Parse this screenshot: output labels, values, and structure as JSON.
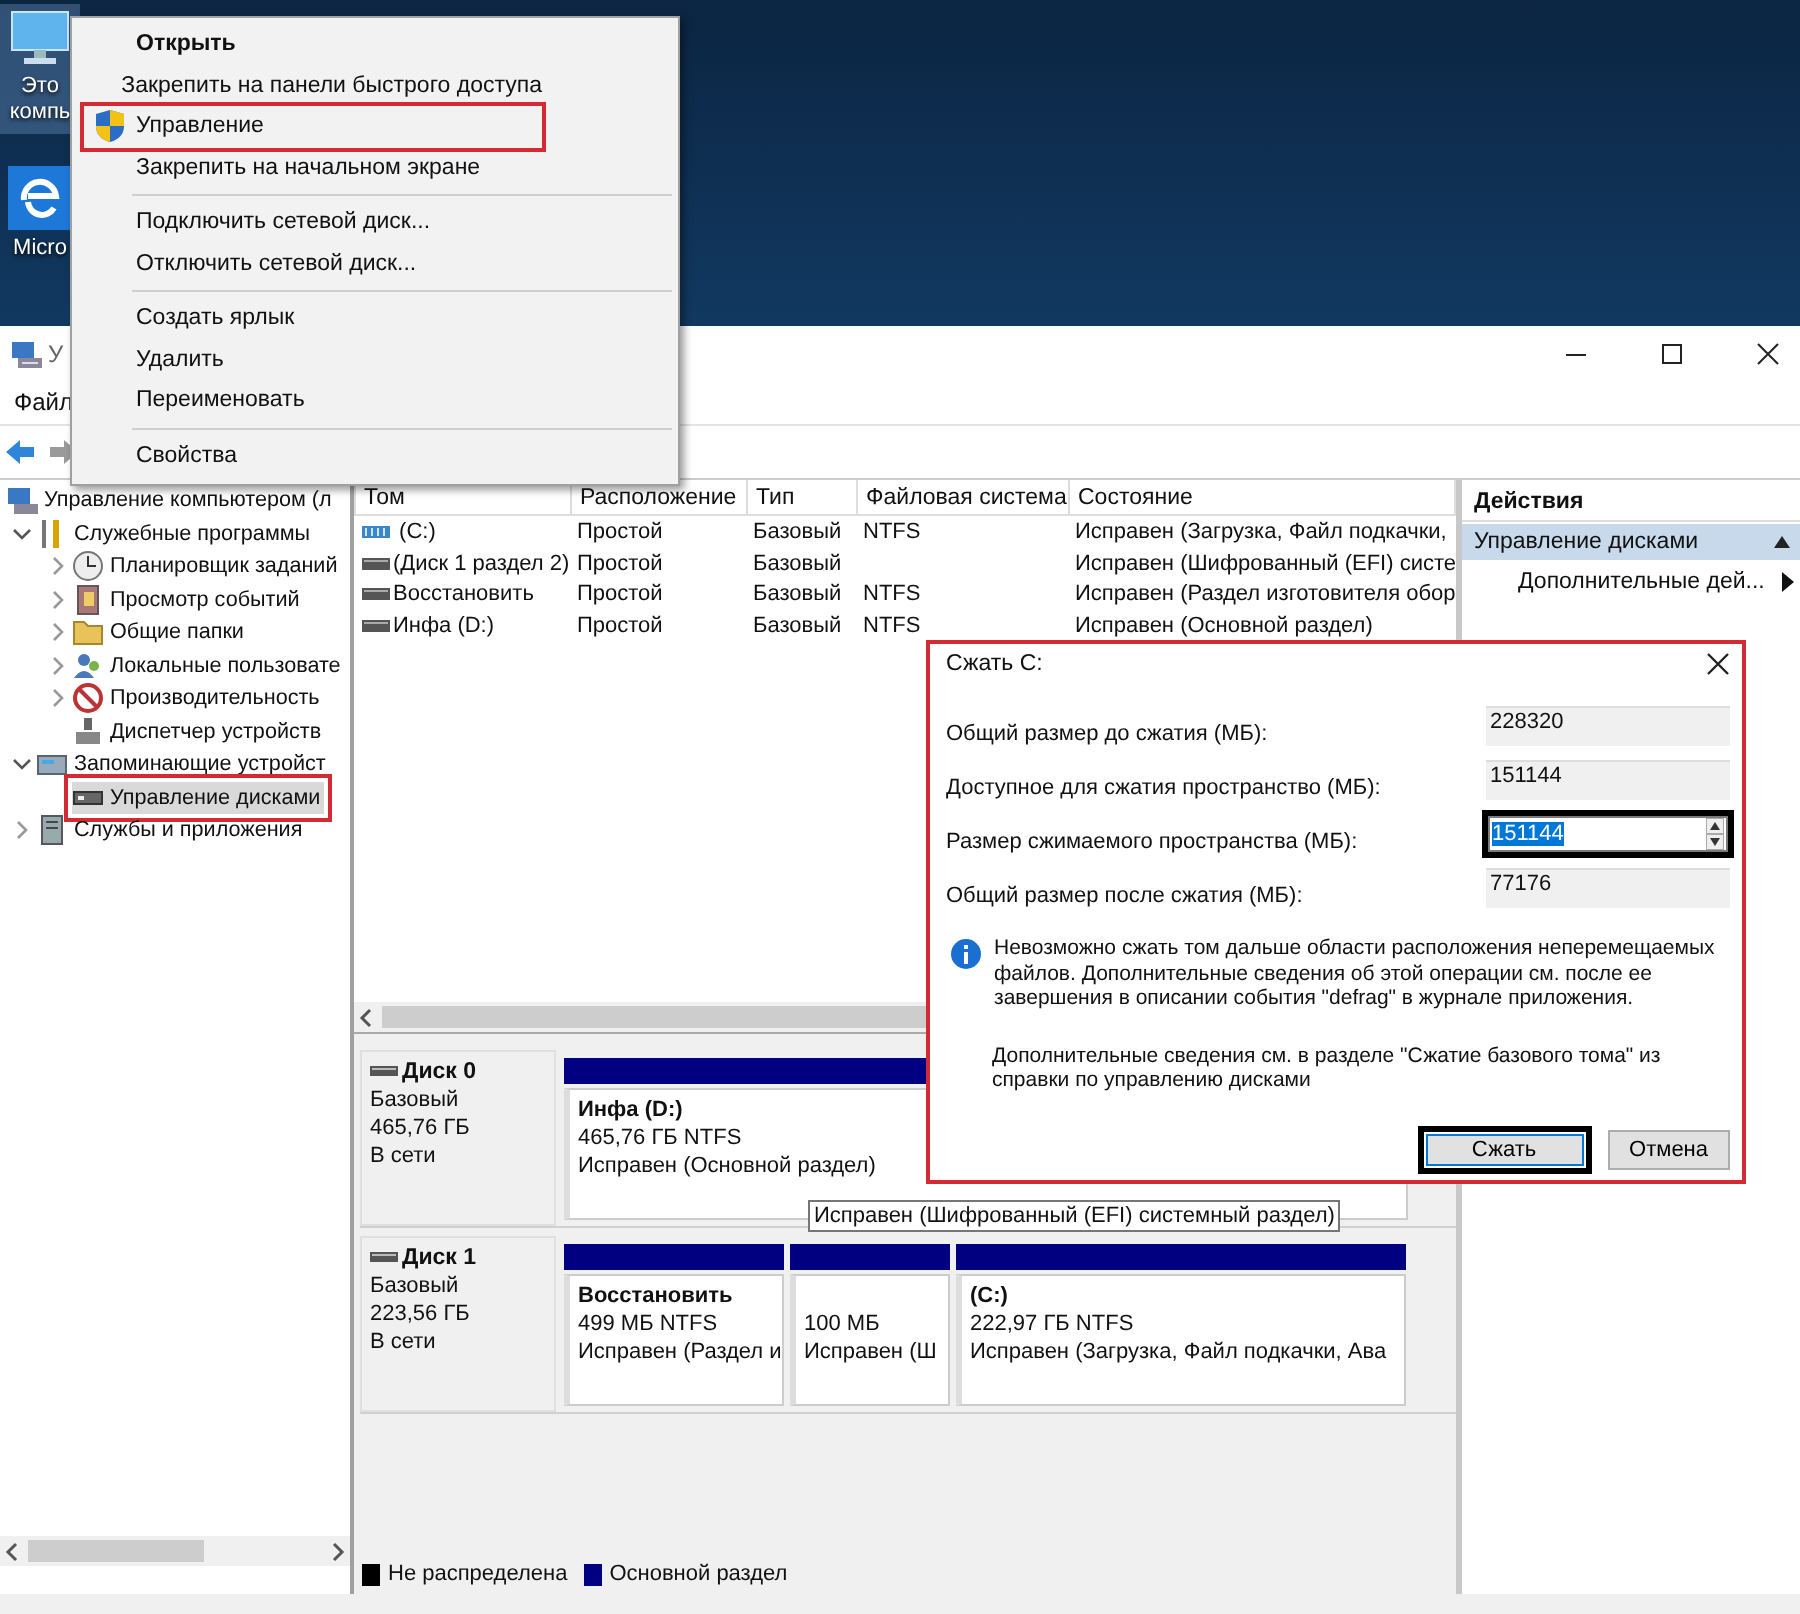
{
  "desktop": {
    "icons": [
      {
        "kind": "computer",
        "label_lines": [
          "Это",
          "компь"
        ],
        "selected": true
      },
      {
        "kind": "browser",
        "label_lines": [
          "Micro"
        ],
        "selected": false
      }
    ]
  },
  "window": {
    "title": "У",
    "menu": [
      "Файл"
    ],
    "tree": [
      {
        "label": "Управление компьютером (л",
        "kind": "computer",
        "selected": false,
        "outlined": false,
        "children": [
          {
            "label": "Служебные программы",
            "kind": "tools",
            "expanded": true,
            "selected": false,
            "outlined": false,
            "children": [
              {
                "label": "Планировщик заданий",
                "kind": "clock",
                "expanded": false,
                "selected": false,
                "outlined": false
              },
              {
                "label": "Просмотр событий",
                "kind": "log",
                "expanded": false,
                "selected": false,
                "outlined": false
              },
              {
                "label": "Общие папки",
                "kind": "folder",
                "expanded": false,
                "selected": false,
                "outlined": false
              },
              {
                "label": "Локальные пользовате",
                "kind": "users",
                "expanded": false,
                "selected": false,
                "outlined": false
              },
              {
                "label": "Производительность",
                "kind": "perf",
                "expanded": false,
                "selected": false,
                "outlined": false
              },
              {
                "label": "Диспетчер устройств",
                "kind": "device",
                "selected": false,
                "outlined": false
              }
            ]
          },
          {
            "label": "Запоминающие устройст",
            "kind": "storage",
            "expanded": true,
            "selected": false,
            "outlined": false,
            "children": [
              {
                "label": "Управление дисками",
                "kind": "disk",
                "selected": true,
                "outlined": true
              }
            ]
          },
          {
            "label": "Службы и приложения",
            "kind": "services",
            "expanded": false,
            "selected": false,
            "outlined": false
          }
        ]
      }
    ],
    "table": {
      "columns": [
        "Том",
        "Расположение",
        "Тип",
        "Файловая система",
        "Состояние"
      ],
      "rows": [
        {
          "kind": "striped",
          "volume": " (C:)",
          "layout": "Простой",
          "type": "Базовый",
          "fs": "NTFS",
          "status": "Исправен (Загрузка, Файл подкачки,"
        },
        {
          "kind": "plain",
          "volume": "(Диск 1 раздел 2)",
          "layout": "Простой",
          "type": "Базовый",
          "status": "Исправен (Шифрованный (EFI) систе"
        },
        {
          "kind": "plain",
          "volume": "Восстановить",
          "layout": "Простой",
          "type": "Базовый",
          "fs": "NTFS",
          "status": "Исправен (Раздел изготовителя обор"
        },
        {
          "kind": "plain",
          "volume": "Инфа (D:)",
          "layout": "Простой",
          "type": "Базовый",
          "fs": "NTFS",
          "status": "Исправен (Основной раздел)"
        }
      ]
    },
    "disks": [
      {
        "name": "Диск 0",
        "type": "Базовый",
        "size": "465,76 ГБ",
        "status": "В сети",
        "partitions": [
          {
            "kind": "primary",
            "title": "Инфа  (D:)",
            "size": "465,76 ГБ NTFS",
            "status": "Исправен (Основной раздел)"
          }
        ]
      },
      {
        "name": "Диск 1",
        "type": "Базовый",
        "size": "223,56 ГБ",
        "status": "В сети",
        "partitions": [
          {
            "kind": "primary",
            "title": "Восстановить",
            "size": "499 МБ NTFS",
            "status": "Исправен (Раздел и"
          },
          {
            "kind": "primary",
            "size": "100 МБ",
            "status": "Исправен (Ш"
          },
          {
            "kind": "primary",
            "title": " (C:)",
            "size": "222,97 ГБ NTFS",
            "status": "Исправен (Загрузка, Файл подкачки, Ава"
          }
        ]
      }
    ],
    "legend": [
      {
        "kind": "unallocated",
        "label": "Не распределена",
        "color": "#000000"
      },
      {
        "kind": "primary",
        "label": "Основной раздел",
        "color": "#000080"
      }
    ],
    "tooltip": "Исправен (Шифрованный (EFI) системный раздел)",
    "actions": {
      "title": "Действия",
      "sections": [
        {
          "label": "Управление дисками",
          "expanded": true,
          "items": [
            {
              "label": "Дополнительные дей...",
              "kind": "submenu"
            }
          ]
        }
      ]
    }
  },
  "context_menu": {
    "groups": [
      [
        {
          "label": "Открыть",
          "kind": "plain",
          "default": true,
          "outlined": false
        },
        {
          "label": "Закрепить на панели быстрого доступа",
          "kind": "plain",
          "default": false,
          "outlined": false
        },
        {
          "label": "Управление",
          "kind": "admin",
          "default": false,
          "outlined": true
        },
        {
          "label": "Закрепить на начальном экране",
          "kind": "plain",
          "default": false,
          "outlined": false
        }
      ],
      [
        {
          "label": "Подключить сетевой диск...",
          "kind": "plain",
          "default": false,
          "outlined": false
        },
        {
          "label": "Отключить сетевой диск...",
          "kind": "plain",
          "default": false,
          "outlined": false
        }
      ],
      [
        {
          "label": "Создать ярлык",
          "kind": "plain",
          "default": false,
          "outlined": false
        },
        {
          "label": "Удалить",
          "kind": "plain",
          "default": false,
          "outlined": false
        },
        {
          "label": "Переименовать",
          "kind": "plain",
          "default": false,
          "outlined": false
        }
      ],
      [
        {
          "label": "Свойства",
          "kind": "plain",
          "default": false,
          "outlined": false
        }
      ]
    ]
  },
  "dialog": {
    "title": "Сжать C:",
    "outlined": true,
    "fields": [
      {
        "label": "Общий размер до сжатия (МБ):",
        "value": "228320",
        "kind": "readonly"
      },
      {
        "label": "Доступное для сжатия пространство (МБ):",
        "value": "151144",
        "kind": "readonly"
      },
      {
        "label": "Размер сжимаемого пространства (МБ):",
        "value": "151144",
        "kind": "spinner",
        "outlined": true,
        "text_selected": true
      },
      {
        "label": "Общий размер после сжатия (МБ):",
        "value": "77176",
        "kind": "readonly"
      }
    ],
    "info": "Невозможно сжать том дальше области расположения неперемещаемых файлов. Дополнительные сведения об этой операции см. после ее завершения в описании события \"defrag\" в журнале приложения.",
    "help": "Дополнительные сведения см. в разделе \"Сжатие базового тома\" из справки по управлению дисками",
    "buttons": [
      {
        "label": "Сжать",
        "default": true,
        "outlined": true
      },
      {
        "label": "Отмена",
        "default": false,
        "outlined": false
      }
    ]
  }
}
